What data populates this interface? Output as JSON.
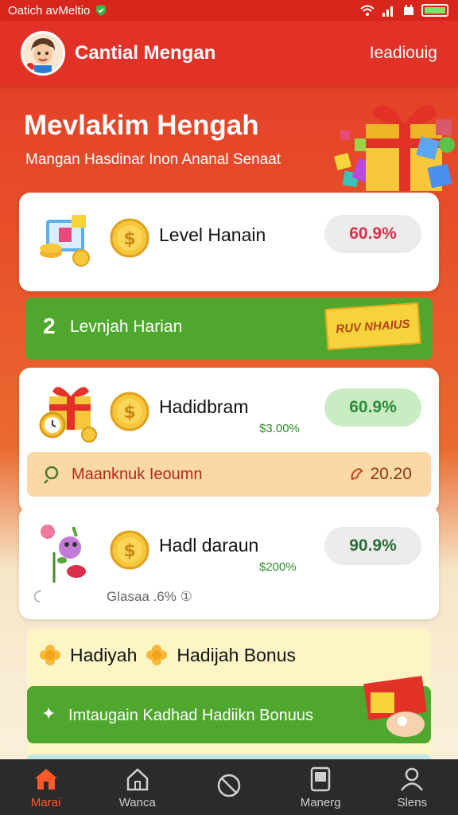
{
  "status_bar": {
    "carrier": "Oatich avMeltio"
  },
  "header": {
    "title": "Cantial Mengan",
    "action": "Ieadiouig"
  },
  "hero": {
    "title": "Mevlakim Hengah",
    "subtitle": "Mangan Hasdinar Inon Ananal Senaat"
  },
  "cards": [
    {
      "label": "Level Hanain",
      "value": "60.9%",
      "sub": ""
    },
    {
      "label": "Hadidbram",
      "value": "60.9%",
      "sub": "$3.00%"
    },
    {
      "label": "Hadl daraun",
      "value": "90.9%",
      "sub": "$200%"
    }
  ],
  "green_banner": {
    "number": "2",
    "text": "Levnjah Harian",
    "tag": "RUV NHAIUS"
  },
  "orange_bar": {
    "text": "Maanknuk Ieoumn",
    "value": "20.20"
  },
  "card3_footer": {
    "text": "Glasaa .6% ①"
  },
  "bonus": {
    "row_label_1": "Hadiyah",
    "row_label_2": "Hadijah Bonus",
    "button_text": "Imtaugain Kadhad Hadiikn Bonuus"
  },
  "nav": [
    {
      "label": "Marai",
      "icon": "home-icon"
    },
    {
      "label": "Wanca",
      "icon": "house-outline-icon"
    },
    {
      "label": "",
      "icon": "compass-icon"
    },
    {
      "label": "Manerg",
      "icon": "tablet-icon"
    },
    {
      "label": "Slens",
      "icon": "user-icon"
    }
  ],
  "colors": {
    "brand_red": "#e23228",
    "accent_green": "#4fa72e",
    "banner_orange": "#fbd9a6"
  }
}
